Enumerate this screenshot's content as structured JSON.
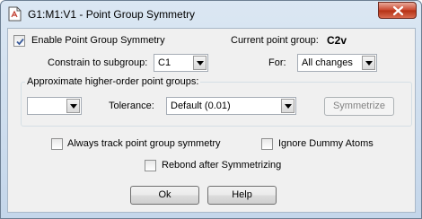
{
  "window": {
    "title": "G1:M1:V1 - Point Group Symmetry"
  },
  "options": {
    "enable_label": "Enable Point Group Symmetry",
    "enable_checked": true,
    "current_label": "Current point group:",
    "current_value": "C2v",
    "constrain_label": "Constrain to subgroup:",
    "constrain_value": "C1",
    "for_label": "For:",
    "for_value": "All changes"
  },
  "approx": {
    "group_label": "Approximate higher-order point groups:",
    "group_select_value": "",
    "tolerance_label": "Tolerance:",
    "tolerance_value": "Default (0.01)",
    "symmetrize_label": "Symmetrize"
  },
  "checks": {
    "always_track_label": "Always track point group symmetry",
    "always_track_checked": false,
    "ignore_dummy_label": "Ignore Dummy Atoms",
    "ignore_dummy_checked": false,
    "rebond_label": "Rebond after Symmetrizing",
    "rebond_checked": false
  },
  "buttons": {
    "ok_label": "Ok",
    "help_label": "Help"
  }
}
